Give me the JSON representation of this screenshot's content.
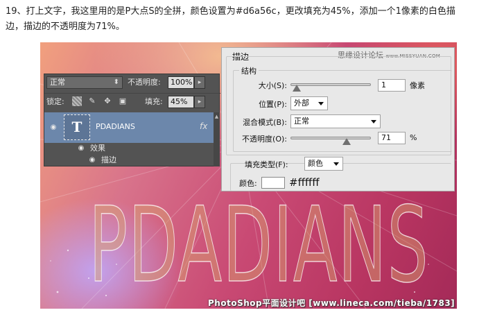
{
  "instruction": {
    "line1": "19、打上文字，我这里用的是P大点S的全拼，颜色设置为#d6a56c，更改填充为45%，添加一个1像素的白色描",
    "line2": "边，描边的不透明度为71%。"
  },
  "canvas": {
    "big_text": "PDADIANS",
    "watermark": "PhotoShop平面设计吧  [www.lineca.com/tieba/1783]"
  },
  "layers_panel": {
    "blend_mode": "正常",
    "opacity_label": "不透明度:",
    "opacity_value": "100%",
    "lock_label": "锁定:",
    "fill_label": "填充:",
    "fill_value": "45%",
    "layer_name": "PDADIANS",
    "thumb_glyph": "T",
    "fx_glyph": "fx",
    "effects_label": "效果",
    "stroke_effect_label": "描边"
  },
  "stroke_dialog": {
    "title": "描边",
    "watermark_cn": "思缘设计论坛",
    "watermark_url": "www.MISSYUAN.COM",
    "structure_label": "结构",
    "size_label": "大小(S):",
    "size_value": "1",
    "size_unit": "像素",
    "size_fraction": 0.02,
    "position_label": "位置(P):",
    "position_value": "外部",
    "blend_label": "混合模式(B):",
    "blend_value": "正常",
    "opacity_label": "不透明度(O):",
    "opacity_value": "71",
    "opacity_unit": "%",
    "opacity_fraction": 0.71,
    "fill_type_label": "填充类型(F):",
    "fill_type_value": "颜色",
    "color_label": "颜色:",
    "color_hex_text": "#ffffff",
    "swatch_color": "#ffffff"
  }
}
